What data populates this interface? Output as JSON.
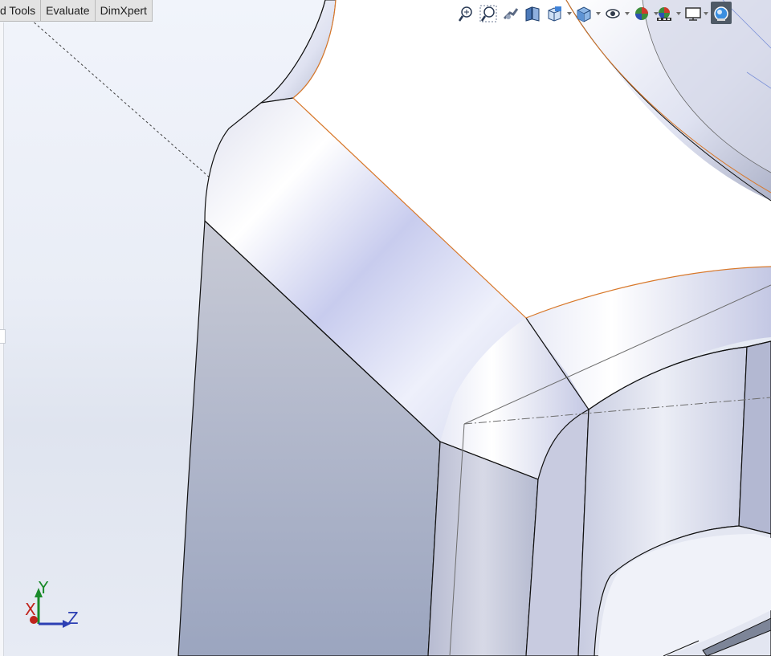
{
  "ribbon": {
    "tabs": [
      "d Tools",
      "Evaluate",
      "DimXpert"
    ]
  },
  "heads_up_toolbar": {
    "buttons": [
      "zoom-to-fit-icon",
      "zoom-to-area-icon",
      "previous-view-icon",
      "section-view-icon",
      "view-orientation-icon",
      "display-style-icon",
      "hide-show-items-icon",
      "edit-appearance-icon",
      "apply-scene-icon",
      "view-settings-icon",
      "realview-icon"
    ]
  },
  "triad": {
    "x_label": "X",
    "y_label": "Y",
    "z_label": "Z",
    "colors": {
      "x": "#c0241c",
      "y": "#1a8a2a",
      "z": "#2c3fb3"
    }
  },
  "colors": {
    "background_top": "#f1f4fb",
    "background_bottom": "#dfe4ef",
    "model_highlight": "#ffffff",
    "model_face": "#a9b3cc",
    "selected_edge": "#d8782a"
  }
}
